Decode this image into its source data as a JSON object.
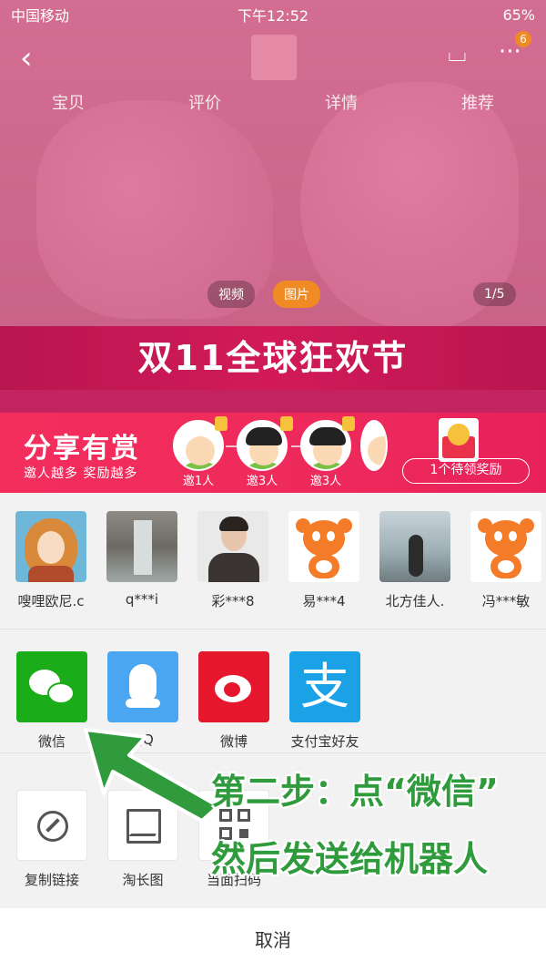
{
  "status_bar": {
    "carrier": "中国移动",
    "time": "下午12:52",
    "battery": "65%"
  },
  "nav": {
    "cart_badge": "6"
  },
  "product_tabs": [
    "宝贝",
    "评价",
    "详情",
    "推荐"
  ],
  "media_toggle": {
    "video": "视频",
    "image": "图片",
    "counter": "1/5"
  },
  "festival_banner": "双11全球狂欢节",
  "reward_banner": {
    "title": "分享有赏",
    "subtitle": "邀人越多 奖励越多",
    "steps": [
      "邀1人",
      "邀3人",
      "邀3人"
    ],
    "claim_button": "1个待领奖励"
  },
  "contacts": [
    {
      "name": "嗖哩欧尼.c",
      "avatar": "girl-illustration"
    },
    {
      "name": "q***i",
      "avatar": "waterfall-photo"
    },
    {
      "name": "彩***8",
      "avatar": "man-photo"
    },
    {
      "name": "易***4",
      "avatar": "mascot-avatar"
    },
    {
      "name": "北方佳人.",
      "avatar": "lake-photo"
    },
    {
      "name": "冯***敏",
      "avatar": "mascot-avatar"
    }
  ],
  "share_apps": [
    {
      "label": "微信",
      "icon": "wechat-icon"
    },
    {
      "label": "QQ",
      "icon": "qq-icon"
    },
    {
      "label": "微博",
      "icon": "weibo-icon"
    },
    {
      "label": "支付宝好友",
      "icon": "alipay-icon"
    }
  ],
  "tools": [
    {
      "label": "复制链接",
      "icon": "link-icon"
    },
    {
      "label": "淘长图",
      "icon": "image-icon"
    },
    {
      "label": "当面扫码",
      "icon": "qr-code-icon"
    }
  ],
  "cancel_label": "取消",
  "alipay_glyph": "支",
  "instruction": {
    "line1": "第二步：点“微信”",
    "line2": "然后发送给机器人"
  },
  "colors": {
    "accent": "#f32e5d",
    "wechat": "#1aad19",
    "instruction_green": "#2f9b3c"
  }
}
